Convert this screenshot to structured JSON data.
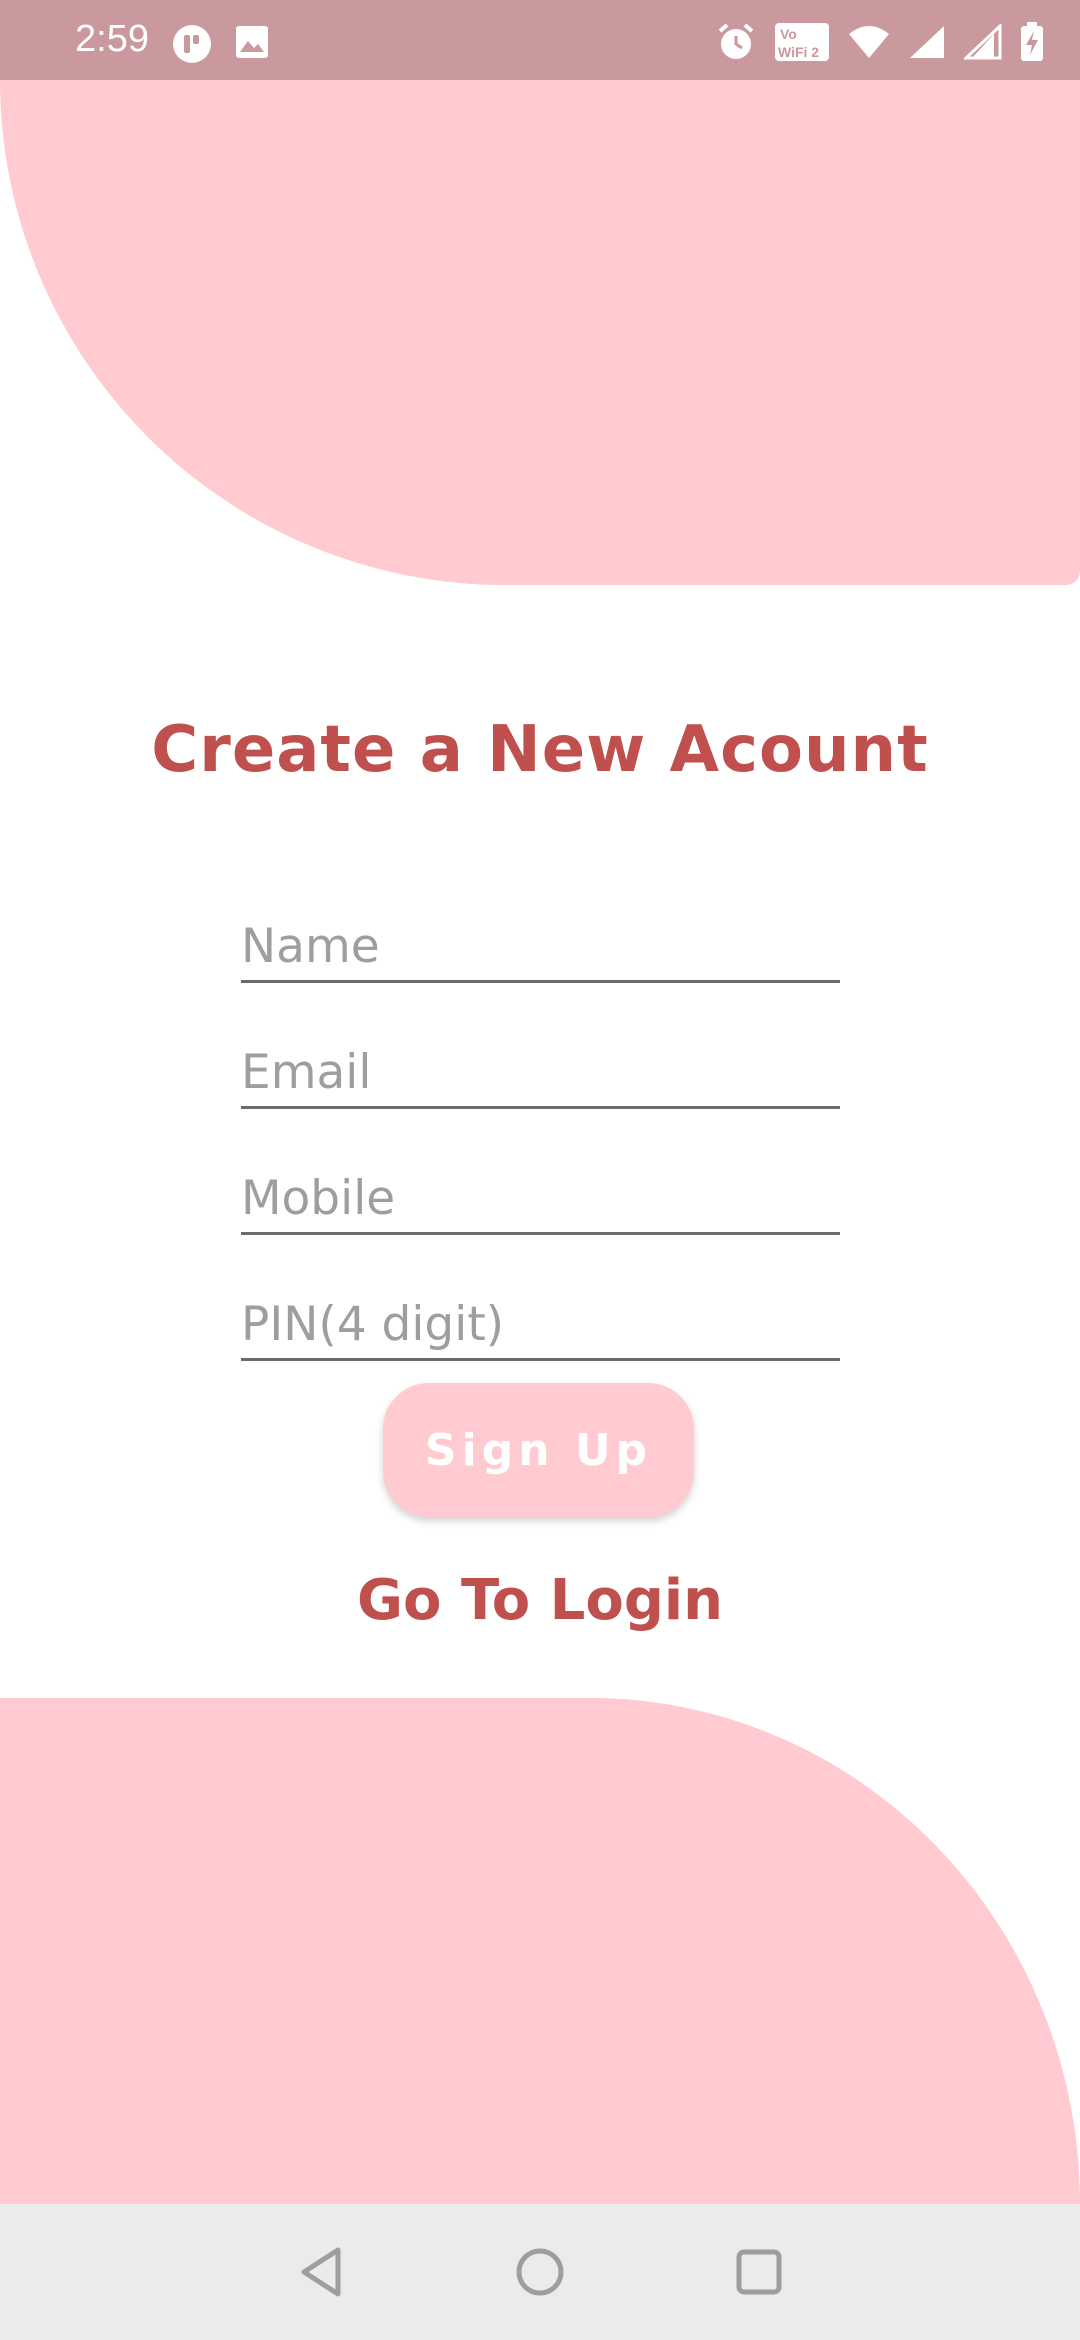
{
  "status_bar": {
    "time": "2:59",
    "left_icons": [
      "app-notification-icon",
      "image-icon"
    ],
    "right_icons": [
      "alarm-icon",
      "vowifi-icon",
      "wifi-icon",
      "signal-icon",
      "signal-2-icon",
      "battery-charging-icon"
    ],
    "vowifi_label_top": "Vo",
    "vowifi_label_bottom": "WiFi 2"
  },
  "page": {
    "title": "Create a New Acount"
  },
  "form": {
    "name_placeholder": "Name",
    "email_placeholder": "Email",
    "mobile_placeholder": "Mobile",
    "pin_placeholder": "PIN(4 digit)",
    "signup_label": "Sign Up"
  },
  "links": {
    "go_to_login": "Go To Login"
  },
  "nav_bar": {
    "buttons": [
      "back-icon",
      "home-icon",
      "recents-icon"
    ]
  },
  "colors": {
    "status_bar": "#c9999e",
    "shape": "#ffcbd0",
    "accent": "#c0504d",
    "nav_bar": "#ebebeb"
  }
}
